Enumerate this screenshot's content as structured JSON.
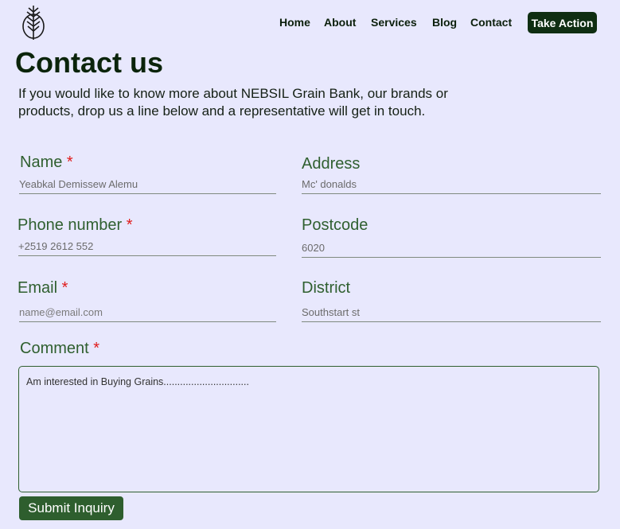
{
  "nav": {
    "items": [
      "Home",
      "About",
      "Services",
      "Blog",
      "Contact"
    ],
    "cta_label": "Take Action"
  },
  "page": {
    "title": "Contact us",
    "intro": "If you would like to know more about NEBSIL Grain Bank, our brands or products, drop us a line below and a representative will get in touch."
  },
  "form": {
    "required_marker": "*",
    "name": {
      "label": "Name",
      "value": "Yeabkal Demissew Alemu"
    },
    "address": {
      "label": "Address",
      "value": "Mc' donalds"
    },
    "phone": {
      "label": "Phone number",
      "value": "+2519 2612 552"
    },
    "postcode": {
      "label": "Postcode",
      "value": "6020"
    },
    "email": {
      "label": "Email",
      "placeholder": "name@email.com"
    },
    "district": {
      "label": "District",
      "value": "Southstart st"
    },
    "comment": {
      "label": "Comment",
      "value": "Am interested in Buying Grains..............................."
    },
    "submit_label": "Submit Inquiry"
  },
  "colors": {
    "background": "#e8e8fd",
    "brand_dark": "#0f2e12",
    "label_green": "#2f5f2f",
    "required_red": "#e01b1b"
  },
  "icons": {
    "logo": "wheat-logo-icon"
  }
}
